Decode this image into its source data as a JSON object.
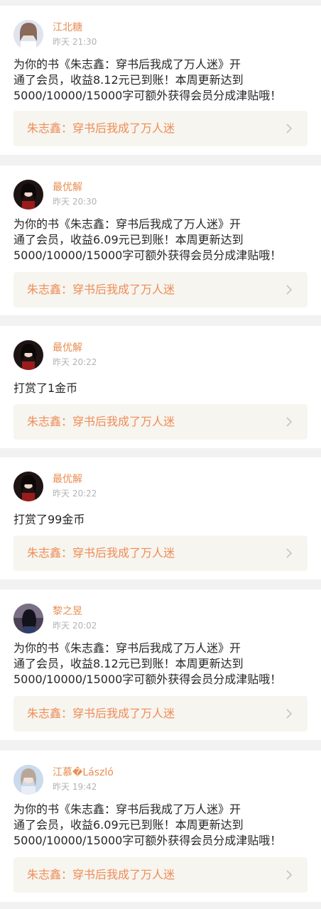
{
  "feed": [
    {
      "user": "江北糖",
      "time": "昨天 21:30",
      "message": "为你的书《朱志鑫：穿书后我成了万人迷》开\n通了会员，收益8.12元已到账！本周更新达到\n5000/10000/15000字可额外获得会员分成津贴哦！",
      "book": "朱志鑫：穿书后我成了万人迷",
      "avatar_color": "#cfd6e3"
    },
    {
      "user": "最优解",
      "time": "昨天 20:30",
      "message": "为你的书《朱志鑫：穿书后我成了万人迷》开\n通了会员，收益6.09元已到账！本周更新达到\n5000/10000/15000字可额外获得会员分成津贴哦！",
      "book": "朱志鑫：穿书后我成了万人迷",
      "avatar_color": "#2a1c1c"
    },
    {
      "user": "最优解",
      "time": "昨天 20:22",
      "message": "打赏了1金币",
      "book": "朱志鑫：穿书后我成了万人迷",
      "avatar_color": "#2a1c1c"
    },
    {
      "user": "最优解",
      "time": "昨天 20:22",
      "message": "打赏了99金币",
      "book": "朱志鑫：穿书后我成了万人迷",
      "avatar_color": "#2a1c1c"
    },
    {
      "user": "黎之昱",
      "time": "昨天 20:02",
      "message": "为你的书《朱志鑫：穿书后我成了万人迷》开\n通了会员，收益8.12元已到账！本周更新达到\n5000/10000/15000字可额外获得会员分成津贴哦！",
      "book": "朱志鑫：穿书后我成了万人迷",
      "avatar_color": "#3a3346"
    },
    {
      "user": "江慕�László",
      "time": "昨天 19:42",
      "message": "为你的书《朱志鑫：穿书后我成了万人迷》开\n通了会员，收益6.09元已到账！本周更新达到\n5000/10000/15000字可额外获得会员分成津贴哦！",
      "book": "朱志鑫：穿书后我成了万人迷",
      "avatar_color": "#b8d0e6"
    }
  ]
}
